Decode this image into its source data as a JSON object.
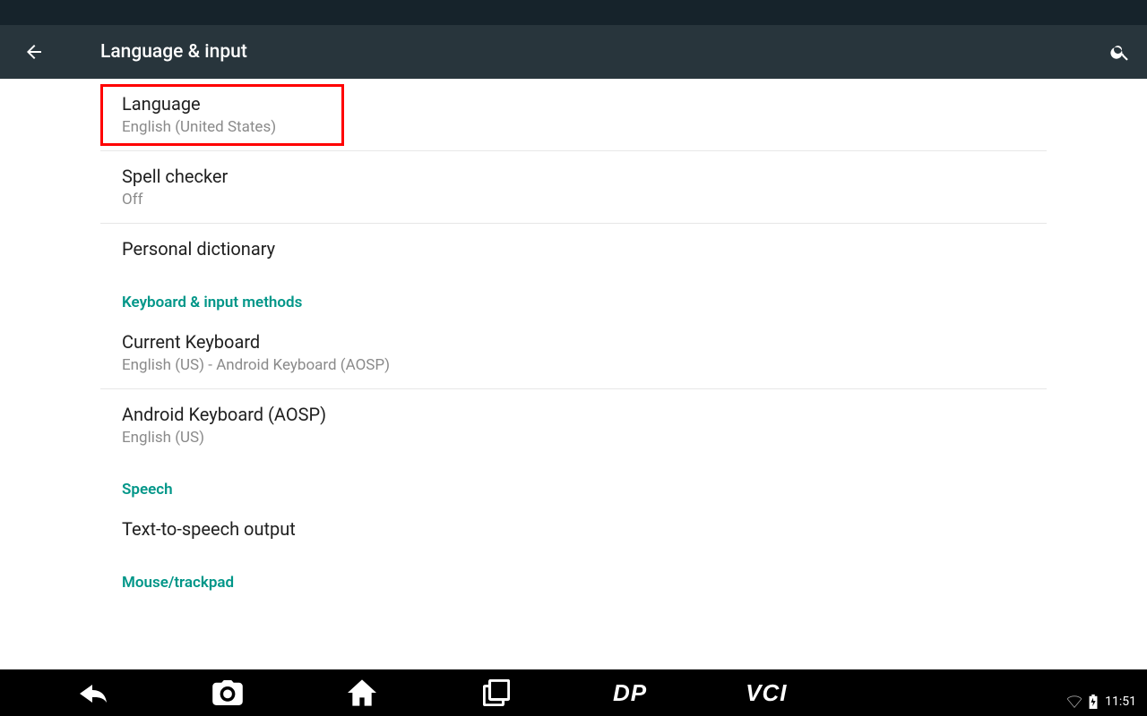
{
  "appbar": {
    "title": "Language & input"
  },
  "items": {
    "language": {
      "title": "Language",
      "subtitle": "English (United States)"
    },
    "spell": {
      "title": "Spell checker",
      "subtitle": "Off"
    },
    "dict": {
      "title": "Personal dictionary"
    },
    "current": {
      "title": "Current Keyboard",
      "subtitle": "English (US) - Android Keyboard (AOSP)"
    },
    "aosp": {
      "title": "Android Keyboard (AOSP)",
      "subtitle": "English (US)"
    },
    "tts": {
      "title": "Text-to-speech output"
    }
  },
  "sections": {
    "keyboard": "Keyboard & input methods",
    "speech": "Speech",
    "mouse": "Mouse/trackpad"
  },
  "navbar": {
    "dp": "DP",
    "vci": "VCI",
    "time": "11:51"
  },
  "highlight": {
    "target": "language"
  }
}
